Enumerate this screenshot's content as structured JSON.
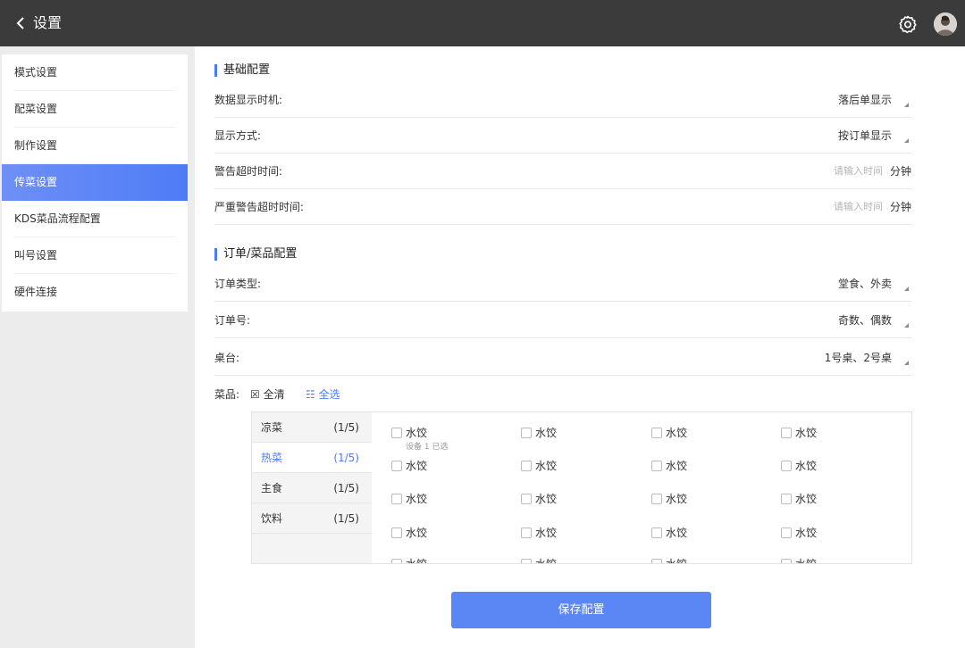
{
  "header": {
    "back_icon": "chevron-left-icon",
    "title": "设置",
    "settings_icon": "gear-icon",
    "avatar_icon": "user-avatar"
  },
  "sidebar": {
    "items": [
      {
        "label": "模式设置"
      },
      {
        "label": "配菜设置"
      },
      {
        "label": "制作设置"
      },
      {
        "label": "传菜设置",
        "active": true
      },
      {
        "label": "KDS菜品流程配置"
      },
      {
        "label": "叫号设置"
      },
      {
        "label": "硬件连接"
      }
    ]
  },
  "basic": {
    "title": "基础配置",
    "data_time": {
      "label": "数据显示时机:",
      "value": "落后单显示"
    },
    "display_mode": {
      "label": "显示方式:",
      "value": "按订单显示"
    },
    "warn_timeout": {
      "label": "警告超时时间:",
      "placeholder": "请输入时间",
      "unit": "分钟"
    },
    "severe_timeout": {
      "label": "严重警告超时时间:",
      "placeholder": "请输入时间",
      "unit": "分钟"
    }
  },
  "order": {
    "title": "订单/菜品配置",
    "order_type": {
      "label": "订单类型:",
      "value": "堂食、外卖"
    },
    "order_no": {
      "label": "订单号:",
      "value": "奇数、偶数"
    },
    "table": {
      "label": "桌台:",
      "value": "1号桌、2号桌"
    },
    "dishes": {
      "label": "菜品:",
      "clear_all": "☒ 全清",
      "select_all": "☷ 全选",
      "categories": [
        {
          "name": "凉菜",
          "count": "(1/5)"
        },
        {
          "name": "热菜",
          "count": "(1/5)",
          "active": true
        },
        {
          "name": "主食",
          "count": "(1/5)"
        },
        {
          "name": "饮料",
          "count": "(1/5)"
        }
      ],
      "item_label": "水饺",
      "item_sub": "设备 1 已选"
    }
  },
  "save_button": "保存配置",
  "colors": {
    "accent": "#4a7cf6",
    "topbar": "#3b3b3b",
    "button": "#5b87f4"
  }
}
